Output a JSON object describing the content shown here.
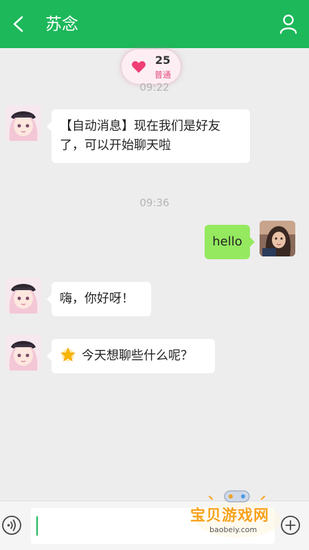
{
  "header": {
    "title": "苏念",
    "back_icon": "back-arrow-icon",
    "profile_icon": "person-icon",
    "color": "#1cb85a"
  },
  "intimacy": {
    "value": "25",
    "level": "普通",
    "icon": "heart-icon"
  },
  "messages": [
    {
      "time": "09:22",
      "side": "left",
      "sender": "苏念",
      "text": "【自动消息】现在我们是好友了，可以开始聊天啦"
    },
    {
      "time": "09:36",
      "side": "right",
      "text": "hello"
    },
    {
      "side": "left",
      "sender": "苏念",
      "text": "嗨，你好呀！"
    },
    {
      "side": "left",
      "sender": "苏念",
      "emoji": "star-icon",
      "text": "今天想聊些什么呢？"
    }
  ],
  "input_bar": {
    "value": "",
    "voice_icon": "voice-icon",
    "plus_icon": "plus-icon"
  },
  "watermark": {
    "title": "宝贝游戏网",
    "url": "baobeiy.com"
  }
}
